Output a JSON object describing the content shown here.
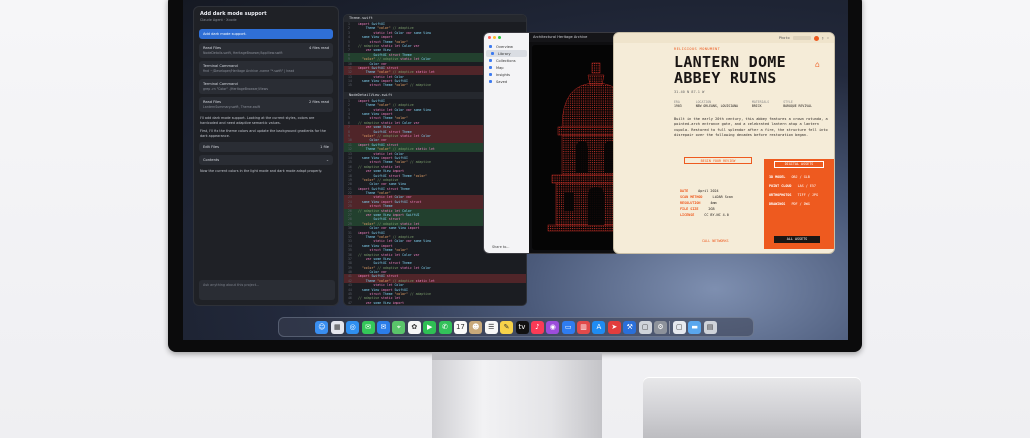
{
  "chat": {
    "title": "Add dark mode support",
    "subtitle": "Claude Agent · Xcode",
    "user_message": "Add dark mode support.",
    "cards": [
      {
        "title": "Read Files",
        "meta": "4 files read",
        "detail": "NodeDetails.swift, HeritageBrowser/AppView.swift"
      },
      {
        "title": "Terminal Command",
        "meta": "",
        "detail": "find ~/Developer/Heritage Archive -name \"*.swift\" | head"
      },
      {
        "title": "Terminal Command",
        "meta": "",
        "detail": "grep -rn \"Color\" ./HeritageBrowser/Views"
      },
      {
        "title": "Read Files",
        "meta": "2 files read",
        "detail": "LanternSummary.swift, Theme.swift"
      },
      {
        "title": "Edit Files",
        "meta": "1 file",
        "detail": ""
      }
    ],
    "summary_1": "I'll add dark mode support. Looking at the current styles, colors are hardcoded and need adaptive semantic values.",
    "summary_2": "First, I'll fix the theme colors and update the background gradients for the dark appearance.",
    "contents_label": "Contents",
    "summary_3": "Now the current colors in the light mode and dark mode adapt properly.",
    "input_placeholder": "Ask anything about this project..."
  },
  "editor": {
    "file_1": "Theme.swift",
    "file_2": "NodeDetailView.swift"
  },
  "drawing": {
    "title": "Architectural Heritage Archive",
    "sidebar": [
      {
        "label": "Overview",
        "active": false
      },
      {
        "label": "Library",
        "active": true
      },
      {
        "label": "Collections",
        "active": false
      },
      {
        "label": "Map",
        "active": false
      },
      {
        "label": "Insights",
        "active": false
      },
      {
        "label": "Saved",
        "active": false
      }
    ],
    "share_label": "Share to..."
  },
  "poster": {
    "toolbar_label": "Photo",
    "type_label": "RELIGIOUS MONUMENT",
    "title_line1": "LANTERN DOME",
    "title_line2": "ABBEY RUINS",
    "coordinates": "31.40 N  87.1 W",
    "meta": [
      {
        "key": "ERA",
        "value": "1903"
      },
      {
        "key": "LOCATION",
        "value": "NEW ORLEANS, LOUISIANA"
      },
      {
        "key": "MATERIALS",
        "value": "BRICK"
      },
      {
        "key": "STYLE",
        "value": "BAROQUE REVIVAL"
      }
    ],
    "description": "Built in the early 20th century, this abbey features a crown rotunda, a pointed-arch entrance gate, and a celebrated lantern atop a lantern cupola. Restored to full splendor after a fire, the structure fell into disrepair over the following decades before restoration began.",
    "survey_button": "BEGIN YOUR REVIEW",
    "specs": [
      {
        "key": "DATE",
        "value": "April 2024"
      },
      {
        "key": "SCAN METHOD",
        "value": "LiDAR Scan"
      },
      {
        "key": "RESOLUTION",
        "value": "4mm"
      },
      {
        "key": "FILE SIZE",
        "value": "2GB"
      },
      {
        "key": "LICENSE",
        "value": "CC BY-NC 4.0"
      }
    ],
    "panel_label": "DIGITAL ASSETS",
    "panel_rows": [
      {
        "key": "3D MODEL",
        "value": "OBJ / GLB"
      },
      {
        "key": "POINT CLOUD",
        "value": "LAS / E57"
      },
      {
        "key": "ORTHOPHOTOS",
        "value": "TIFF / JPG"
      },
      {
        "key": "DRAWINGS",
        "value": "PDF / DWG"
      }
    ],
    "panel_button": "ALL ASSETS",
    "call_button": "CALL NETWORKS"
  },
  "dock": {
    "apps": [
      {
        "name": "finder",
        "color": "#3a8ef0",
        "glyph": "☺"
      },
      {
        "name": "launchpad",
        "color": "#e4e6ee",
        "glyph": "▦"
      },
      {
        "name": "safari",
        "color": "#2f8ff0",
        "glyph": "◎"
      },
      {
        "name": "messages",
        "color": "#34c759",
        "glyph": "✉"
      },
      {
        "name": "mail",
        "color": "#2b7de9",
        "glyph": "✉"
      },
      {
        "name": "maps",
        "color": "#5ac46a",
        "glyph": "⌖"
      },
      {
        "name": "photos",
        "color": "#f5f5f5",
        "glyph": "✿"
      },
      {
        "name": "facetime",
        "color": "#2fbf54",
        "glyph": "▶"
      },
      {
        "name": "phone",
        "color": "#33c15a",
        "glyph": "✆"
      },
      {
        "name": "calendar",
        "color": "#fafafa",
        "glyph": "17"
      },
      {
        "name": "contacts",
        "color": "#c9a97a",
        "glyph": "☻"
      },
      {
        "name": "reminders",
        "color": "#f7f7f7",
        "glyph": "☰"
      },
      {
        "name": "notes",
        "color": "#f6d24a",
        "glyph": "✎"
      },
      {
        "name": "tv",
        "color": "#111111",
        "glyph": "tv"
      },
      {
        "name": "music",
        "color": "#fa3b56",
        "glyph": "♪"
      },
      {
        "name": "podcasts",
        "color": "#9c4ddb",
        "glyph": "◉"
      },
      {
        "name": "keynote",
        "color": "#2f7cf0",
        "glyph": "▭"
      },
      {
        "name": "numbers",
        "color": "#e24a4a",
        "glyph": "▥"
      },
      {
        "name": "app-store",
        "color": "#1f8cf2",
        "glyph": "A"
      },
      {
        "name": "testflight",
        "color": "#e23d3d",
        "glyph": "➤"
      },
      {
        "name": "xcode",
        "color": "#2a6fd9",
        "glyph": "⚒"
      },
      {
        "name": "preview",
        "color": "#cfd3da",
        "glyph": "▢"
      },
      {
        "name": "system-settings",
        "color": "#8d929b",
        "glyph": "⚙"
      },
      {
        "name": "downloads",
        "color": "#e6e9ef",
        "glyph": "▢"
      },
      {
        "name": "folder",
        "color": "#5aa7ee",
        "glyph": "▬"
      },
      {
        "name": "trash",
        "color": "#cfd3da",
        "glyph": "▤"
      }
    ]
  }
}
